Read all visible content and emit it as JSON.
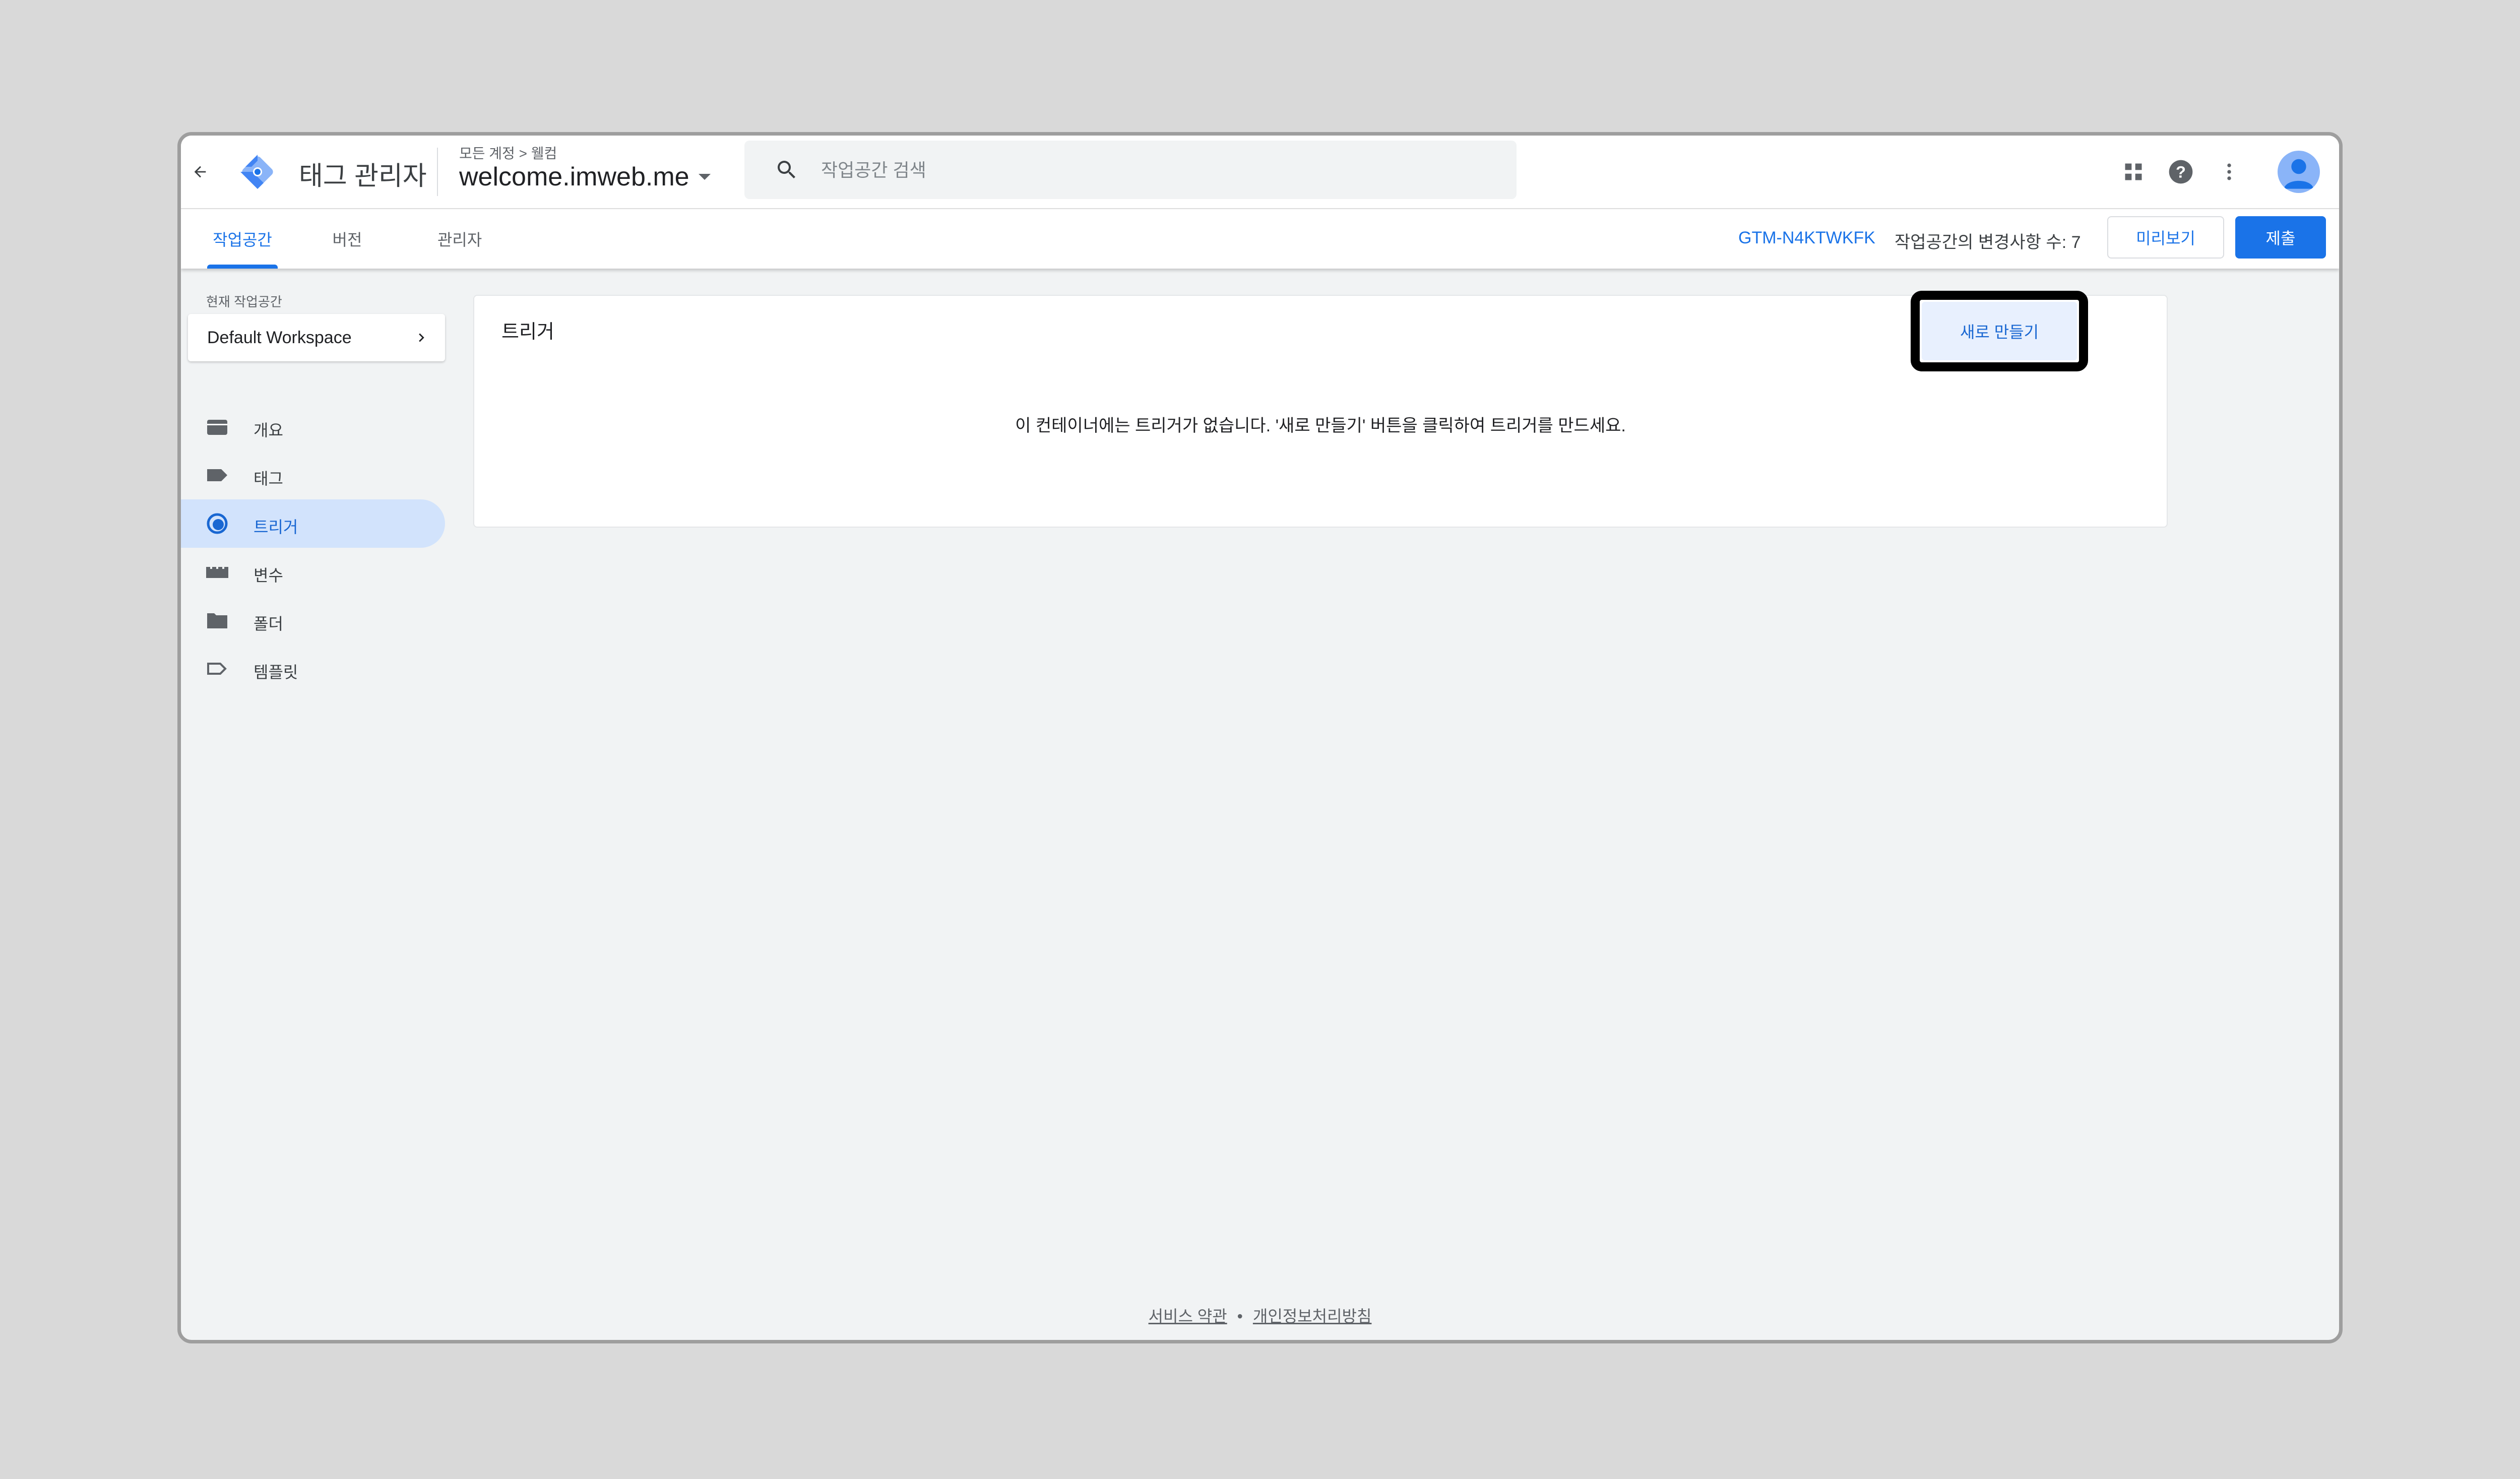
{
  "header": {
    "app_title": "태그 관리자",
    "breadcrumb": "모든 계정 > 웰컴",
    "container_name": "welcome.imweb.me",
    "search_placeholder": "작업공간 검색"
  },
  "tabs": [
    {
      "label": "작업공간",
      "active": true
    },
    {
      "label": "버전",
      "active": false
    },
    {
      "label": "관리자",
      "active": false
    }
  ],
  "toolbar": {
    "container_id": "GTM-N4KTWKFK",
    "workspace_changes": "작업공간의 변경사항 수: 7",
    "preview_label": "미리보기",
    "submit_label": "제출"
  },
  "sidebar": {
    "workspace_label": "현재 작업공간",
    "workspace_name": "Default Workspace",
    "items": [
      {
        "label": "개요",
        "icon": "overview-icon"
      },
      {
        "label": "태그",
        "icon": "tag-icon"
      },
      {
        "label": "트리거",
        "icon": "trigger-icon",
        "active": true
      },
      {
        "label": "변수",
        "icon": "variables-icon"
      },
      {
        "label": "폴더",
        "icon": "folder-icon"
      },
      {
        "label": "템플릿",
        "icon": "template-icon"
      }
    ]
  },
  "main": {
    "card_title": "트리거",
    "new_button_label": "새로 만들기",
    "empty_message": "이 컨테이너에는 트리거가 없습니다. '새로 만들기' 버튼을 클릭하여 트리거를 만드세요."
  },
  "footer": {
    "terms_label": "서비스 약관",
    "separator": "•",
    "privacy_label": "개인정보처리방침"
  },
  "colors": {
    "accent": "#1a73e8",
    "active_nav_bg": "#d2e3fc",
    "new_button_bg": "#e8f0fe"
  }
}
